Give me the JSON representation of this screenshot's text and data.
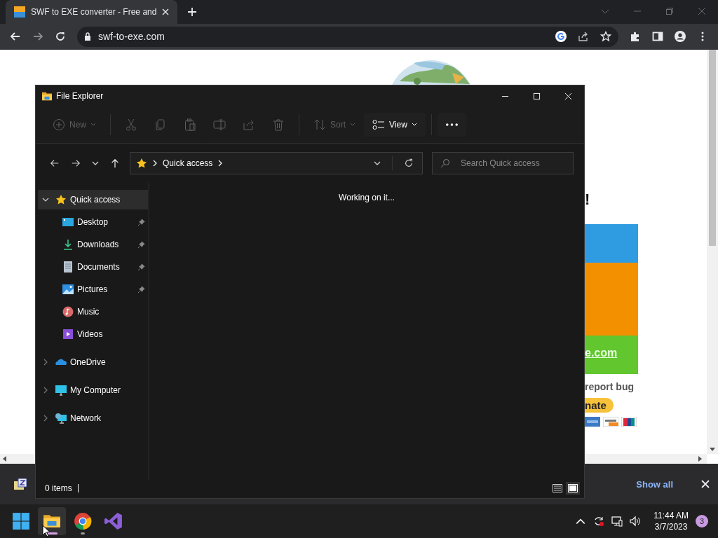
{
  "browser": {
    "tab": {
      "title": "SWF to EXE converter - Free and",
      "selected": true
    },
    "address": "swf-to-exe.com",
    "page": {
      "heading": "!",
      "link": "e.com",
      "bug_text": "report bug",
      "donate": "nate"
    },
    "download_bar": {
      "show_all": "Show all"
    }
  },
  "explorer": {
    "title": "File Explorer",
    "toolbar": [
      {
        "kind": "new",
        "label": "New",
        "disabled": true
      },
      {
        "kind": "cut",
        "disabled": true
      },
      {
        "kind": "copy",
        "disabled": true
      },
      {
        "kind": "paste",
        "disabled": true
      },
      {
        "kind": "rename",
        "disabled": true
      },
      {
        "kind": "share",
        "disabled": true
      },
      {
        "kind": "delete",
        "disabled": true
      },
      {
        "kind": "sort",
        "label": "Sort",
        "disabled": true
      },
      {
        "kind": "view",
        "label": "View",
        "disabled": false
      },
      {
        "kind": "more",
        "disabled": false
      }
    ],
    "path": [
      "Quick access"
    ],
    "search": {
      "placeholder": "Search Quick access"
    },
    "tree": [
      {
        "label": "Quick access",
        "kind": "star",
        "expanded": true,
        "selected": true,
        "children": [
          {
            "label": "Desktop",
            "kind": "desktop",
            "pinned": true,
            "selected": false
          },
          {
            "label": "Downloads",
            "kind": "downloads",
            "pinned": true,
            "selected": false
          },
          {
            "label": "Documents",
            "kind": "documents",
            "pinned": true,
            "selected": false
          },
          {
            "label": "Pictures",
            "kind": "pictures",
            "pinned": true,
            "selected": false
          },
          {
            "label": "Music",
            "kind": "music",
            "pinned": false,
            "selected": false
          },
          {
            "label": "Videos",
            "kind": "videos",
            "pinned": false,
            "selected": false
          }
        ]
      },
      {
        "label": "OneDrive",
        "kind": "cloud",
        "expanded": false,
        "selected": false
      },
      {
        "label": "My Computer",
        "kind": "computer",
        "expanded": false,
        "selected": false
      },
      {
        "label": "Network",
        "kind": "network",
        "expanded": false,
        "selected": false
      }
    ],
    "message": "Working on it...",
    "status": "0 items",
    "views": [
      {
        "kind": "details",
        "selected": false
      },
      {
        "kind": "tiles",
        "selected": true
      }
    ]
  },
  "taskbar": {
    "apps": [
      {
        "kind": "start",
        "selected": false,
        "running": false
      },
      {
        "kind": "explorer",
        "selected": true,
        "running": true
      },
      {
        "kind": "chrome",
        "selected": false,
        "running": true
      },
      {
        "kind": "studio",
        "selected": false,
        "running": false
      }
    ],
    "time": "11:44 AM",
    "date": "3/7/2023",
    "notifications": "3"
  }
}
